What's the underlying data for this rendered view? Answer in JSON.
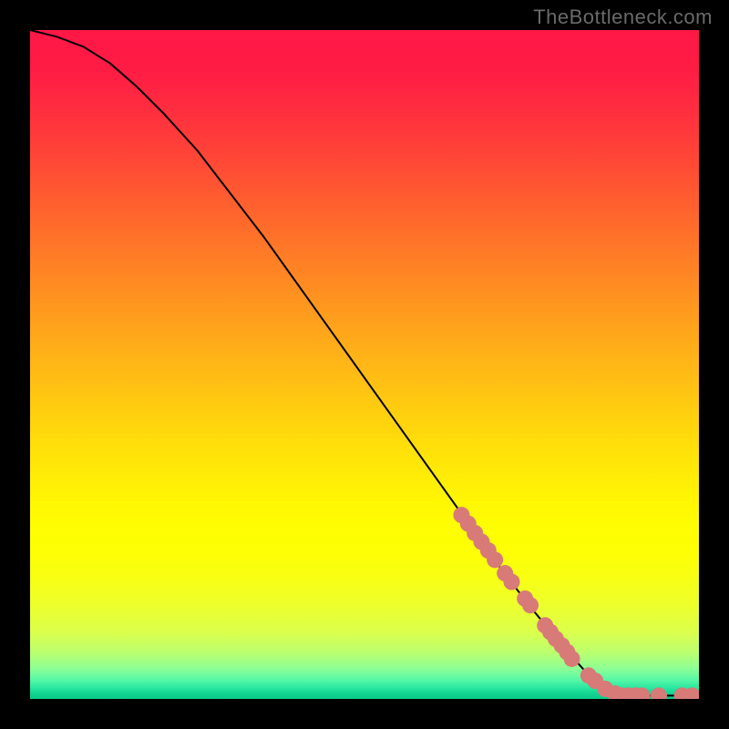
{
  "watermark": "TheBottleneck.com",
  "chart_data": {
    "type": "line",
    "title": "",
    "xlabel": "",
    "ylabel": "",
    "xlim": [
      0,
      100
    ],
    "ylim": [
      0,
      100
    ],
    "curve": [
      {
        "x": 0,
        "y": 100
      },
      {
        "x": 4,
        "y": 99
      },
      {
        "x": 8,
        "y": 97.5
      },
      {
        "x": 12,
        "y": 95
      },
      {
        "x": 16,
        "y": 91.5
      },
      {
        "x": 20,
        "y": 87.5
      },
      {
        "x": 25,
        "y": 82
      },
      {
        "x": 30,
        "y": 75.5
      },
      {
        "x": 35,
        "y": 69
      },
      {
        "x": 40,
        "y": 62
      },
      {
        "x": 45,
        "y": 55
      },
      {
        "x": 50,
        "y": 48
      },
      {
        "x": 55,
        "y": 41
      },
      {
        "x": 60,
        "y": 34
      },
      {
        "x": 65,
        "y": 27
      },
      {
        "x": 70,
        "y": 20
      },
      {
        "x": 75,
        "y": 13.5
      },
      {
        "x": 80,
        "y": 7.5
      },
      {
        "x": 84,
        "y": 3
      },
      {
        "x": 87,
        "y": 1
      },
      {
        "x": 90,
        "y": 0.5
      },
      {
        "x": 100,
        "y": 0.5
      }
    ],
    "markers": [
      {
        "x": 64.5,
        "y": 27.5
      },
      {
        "x": 65.5,
        "y": 26.2
      },
      {
        "x": 66.5,
        "y": 24.8
      },
      {
        "x": 67.5,
        "y": 23.5
      },
      {
        "x": 68.5,
        "y": 22.2
      },
      {
        "x": 69.5,
        "y": 20.8
      },
      {
        "x": 71.0,
        "y": 18.8
      },
      {
        "x": 72.0,
        "y": 17.5
      },
      {
        "x": 74.0,
        "y": 15.0
      },
      {
        "x": 74.8,
        "y": 14.0
      },
      {
        "x": 77.0,
        "y": 11.0
      },
      {
        "x": 77.8,
        "y": 10.0
      },
      {
        "x": 78.6,
        "y": 9.0
      },
      {
        "x": 79.5,
        "y": 8.0
      },
      {
        "x": 80.3,
        "y": 7.0
      },
      {
        "x": 81.0,
        "y": 6.0
      },
      {
        "x": 83.5,
        "y": 3.5
      },
      {
        "x": 84.5,
        "y": 2.7
      },
      {
        "x": 86.0,
        "y": 1.5
      },
      {
        "x": 87.5,
        "y": 0.8
      },
      {
        "x": 88.5,
        "y": 0.5
      },
      {
        "x": 89.5,
        "y": 0.5
      },
      {
        "x": 90.5,
        "y": 0.5
      },
      {
        "x": 91.5,
        "y": 0.5
      },
      {
        "x": 94.0,
        "y": 0.5
      },
      {
        "x": 97.5,
        "y": 0.5
      },
      {
        "x": 99.0,
        "y": 0.5
      }
    ],
    "gradient_stops": [
      {
        "offset": 0.0,
        "color": "#ff1846"
      },
      {
        "offset": 0.06,
        "color": "#ff1c44"
      },
      {
        "offset": 0.12,
        "color": "#ff2e3f"
      },
      {
        "offset": 0.18,
        "color": "#ff4238"
      },
      {
        "offset": 0.24,
        "color": "#ff5831"
      },
      {
        "offset": 0.3,
        "color": "#ff6e2a"
      },
      {
        "offset": 0.36,
        "color": "#ff8424"
      },
      {
        "offset": 0.42,
        "color": "#ff9a1e"
      },
      {
        "offset": 0.48,
        "color": "#ffb018"
      },
      {
        "offset": 0.54,
        "color": "#ffc412"
      },
      {
        "offset": 0.6,
        "color": "#ffd80c"
      },
      {
        "offset": 0.66,
        "color": "#ffea07"
      },
      {
        "offset": 0.7,
        "color": "#fff504"
      },
      {
        "offset": 0.74,
        "color": "#fffd02"
      },
      {
        "offset": 0.78,
        "color": "#feff04"
      },
      {
        "offset": 0.82,
        "color": "#f7ff14"
      },
      {
        "offset": 0.86,
        "color": "#edff2c"
      },
      {
        "offset": 0.9,
        "color": "#dbff4c"
      },
      {
        "offset": 0.93,
        "color": "#bcff6e"
      },
      {
        "offset": 0.955,
        "color": "#8cff96"
      },
      {
        "offset": 0.972,
        "color": "#55f7a6"
      },
      {
        "offset": 0.984,
        "color": "#28e6a0"
      },
      {
        "offset": 0.992,
        "color": "#12d492"
      },
      {
        "offset": 1.0,
        "color": "#0aca88"
      }
    ],
    "marker_color": "#d77a78",
    "marker_radius_px": 9
  }
}
